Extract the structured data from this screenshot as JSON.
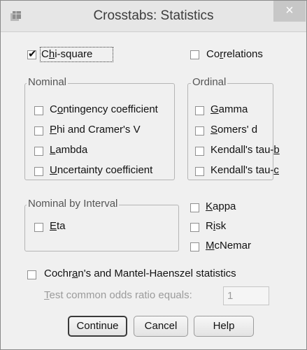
{
  "window": {
    "title": "Crosstabs: Statistics",
    "close_glyph": "×"
  },
  "chi_square": {
    "pre": "C",
    "accel": "h",
    "post": "i-square",
    "checked": true
  },
  "correlations": {
    "pre": "Co",
    "accel": "r",
    "post": "relations",
    "checked": false
  },
  "nominal": {
    "legend": "Nominal",
    "items": [
      {
        "pre": "C",
        "accel": "o",
        "post": "ntingency coefficient"
      },
      {
        "pre": "",
        "accel": "P",
        "post": "hi and Cramer's V"
      },
      {
        "pre": "",
        "accel": "L",
        "post": "ambda"
      },
      {
        "pre": "",
        "accel": "U",
        "post": "ncertainty coefficient"
      }
    ]
  },
  "ordinal": {
    "legend": "Ordinal",
    "items": [
      {
        "pre": "",
        "accel": "G",
        "post": "amma"
      },
      {
        "pre": "",
        "accel": "S",
        "post": "omers' d"
      },
      {
        "pre": "Kendall's tau-",
        "accel": "b",
        "post": ""
      },
      {
        "pre": "Kendall's tau-",
        "accel": "c",
        "post": ""
      }
    ]
  },
  "nominal_by_interval": {
    "legend": "Nominal by Interval",
    "eta": {
      "pre": "",
      "accel": "E",
      "post": "ta"
    }
  },
  "other": {
    "kappa": {
      "pre": "",
      "accel": "K",
      "post": "appa"
    },
    "risk": {
      "pre": "R",
      "accel": "i",
      "post": "sk"
    },
    "mcnemar": {
      "pre": "",
      "accel": "M",
      "post": "cNemar"
    }
  },
  "cochran": {
    "pre": "Cochr",
    "accel": "a",
    "post": "n's and Mantel-Haenszel statistics"
  },
  "odds": {
    "pre": "",
    "accel": "T",
    "post": "est common odds ratio equals:",
    "value": "1"
  },
  "buttons": {
    "continue": "Continue",
    "cancel": "Cancel",
    "help": "Help"
  }
}
